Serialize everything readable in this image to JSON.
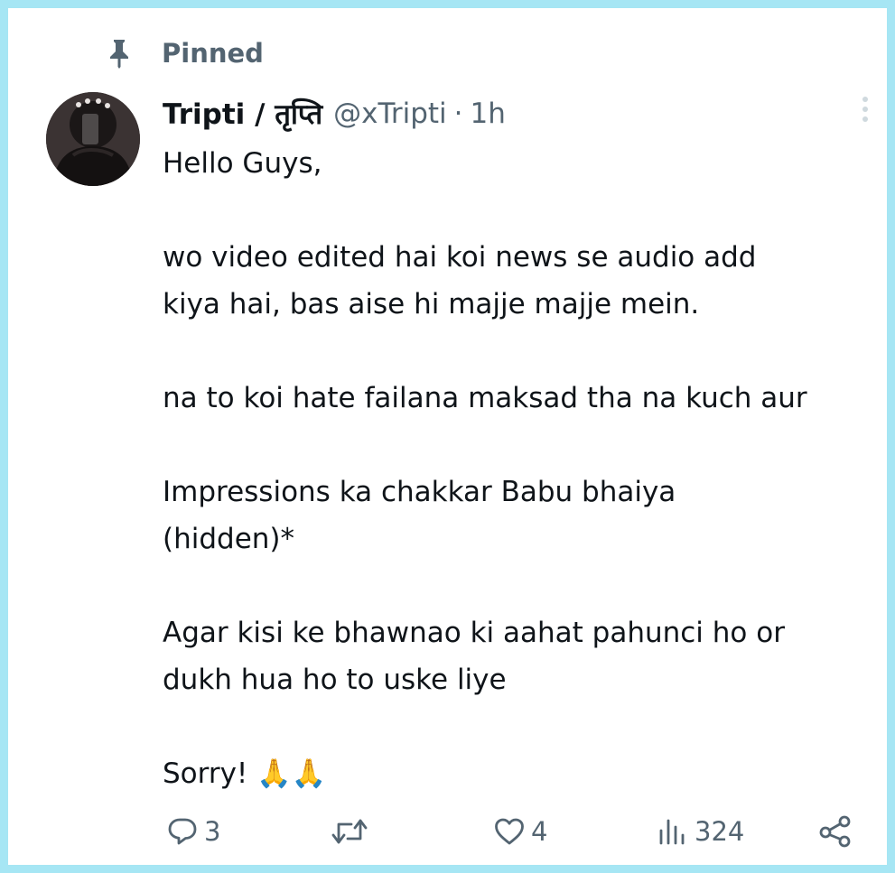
{
  "pinned": {
    "icon": "pin-icon",
    "label": "Pinned"
  },
  "tweet": {
    "display_name": "Tripti / तृप्ति",
    "handle": "@xTripti",
    "separator": "·",
    "time": "1h",
    "more_icon": "more-vertical-icon",
    "lines": [
      "Hello Guys,",
      "",
      "wo video edited hai koi news se audio add",
      "kiya hai, bas aise hi majje majje mein.",
      "",
      "na to koi hate failana maksad tha na kuch aur",
      "",
      "Impressions ka chakkar Babu bhaiya",
      "(hidden)*",
      "",
      "Agar kisi ke bhawnao ki aahat pahunci ho or",
      "dukh hua ho to uske liye",
      "",
      "Sorry! 🙏🙏"
    ]
  },
  "actions": {
    "reply": {
      "icon": "reply-icon",
      "count": "3"
    },
    "retweet": {
      "icon": "retweet-icon",
      "count": ""
    },
    "like": {
      "icon": "heart-icon",
      "count": "4"
    },
    "views": {
      "icon": "views-icon",
      "count": "324"
    },
    "share": {
      "icon": "share-icon"
    }
  },
  "colors": {
    "border": "#a6e6f4",
    "text": "#0f1419",
    "secondary": "#536471"
  }
}
